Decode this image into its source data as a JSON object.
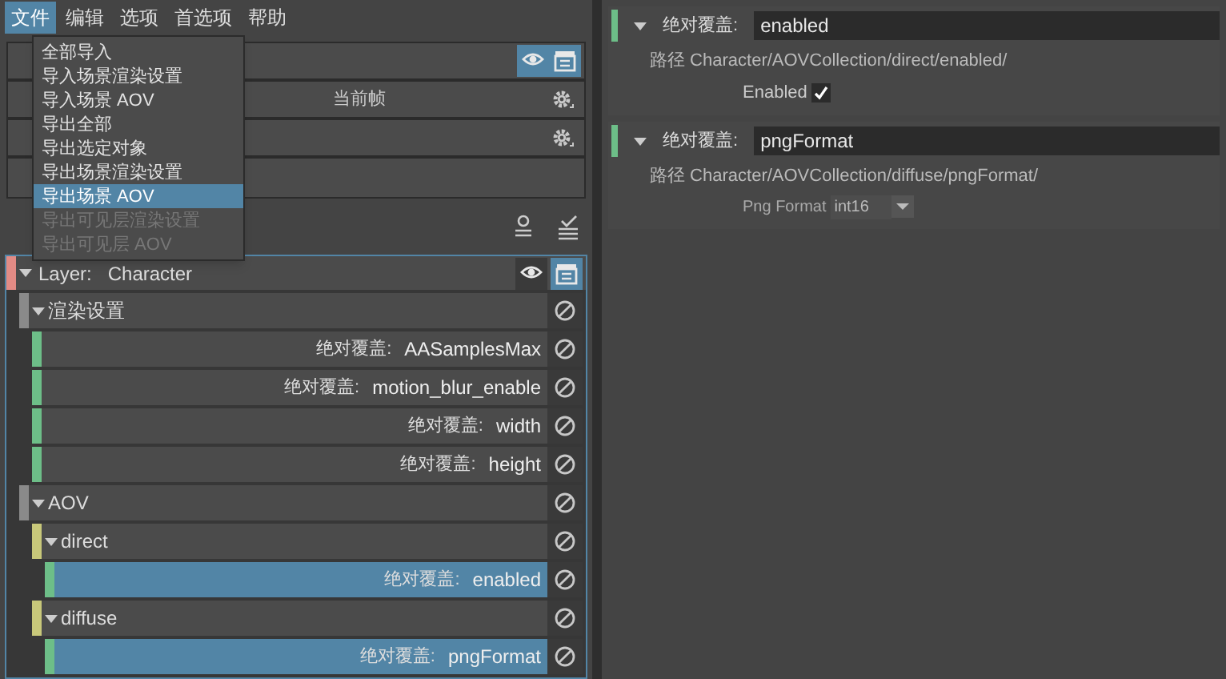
{
  "menu_bar": [
    {
      "label": "文件",
      "selected": true
    },
    {
      "label": "编辑",
      "selected": false
    },
    {
      "label": "选项",
      "selected": false
    },
    {
      "label": "首选项",
      "selected": false
    },
    {
      "label": "帮助",
      "selected": false
    }
  ],
  "file_menu": [
    {
      "label": "全部导入",
      "selected": false,
      "disabled": false
    },
    {
      "label": "导入场景渲染设置",
      "selected": false,
      "disabled": false
    },
    {
      "label": "导入场景 AOV",
      "selected": false,
      "disabled": false
    },
    {
      "label": "导出全部",
      "selected": false,
      "disabled": false
    },
    {
      "label": "导出选定对象",
      "selected": false,
      "disabled": false
    },
    {
      "label": "导出场景渲染设置",
      "selected": false,
      "disabled": false
    },
    {
      "label": "导出场景 AOV",
      "selected": true,
      "disabled": false
    },
    {
      "label": "导出可见层渲染设置",
      "selected": false,
      "disabled": true
    },
    {
      "label": "导出可见层 AOV",
      "selected": false,
      "disabled": true
    }
  ],
  "top_panel": {
    "frame_label": "当前帧"
  },
  "layer": {
    "label": "Layer:",
    "name": "Character",
    "color": "#e38b85",
    "expanded": true,
    "children": [
      {
        "kind": "group",
        "label": "渲染设置",
        "color": "#8a8a8a",
        "expanded": true,
        "children": [
          {
            "kind": "override",
            "prefix": "绝对覆盖:",
            "label": "AASamplesMax",
            "color": "#6dbe88",
            "selected": false
          },
          {
            "kind": "override",
            "prefix": "绝对覆盖:",
            "label": "motion_blur_enable",
            "color": "#6dbe88",
            "selected": false
          },
          {
            "kind": "override",
            "prefix": "绝对覆盖:",
            "label": "width",
            "color": "#6dbe88",
            "selected": false
          },
          {
            "kind": "override",
            "prefix": "绝对覆盖:",
            "label": "height",
            "color": "#6dbe88",
            "selected": false
          }
        ]
      },
      {
        "kind": "group",
        "label": "AOV",
        "color": "#8a8a8a",
        "expanded": true,
        "children": [
          {
            "kind": "group",
            "label": "direct",
            "color": "#c8c87a",
            "expanded": true,
            "children": [
              {
                "kind": "override",
                "prefix": "绝对覆盖:",
                "label": "enabled",
                "color": "#6dbe88",
                "selected": true
              }
            ]
          },
          {
            "kind": "group",
            "label": "diffuse",
            "color": "#c8c87a",
            "expanded": true,
            "children": [
              {
                "kind": "override",
                "prefix": "绝对覆盖:",
                "label": "pngFormat",
                "color": "#6dbe88",
                "selected": true
              }
            ]
          }
        ]
      }
    ]
  },
  "properties": [
    {
      "label": "绝对覆盖:",
      "value": "enabled",
      "color": "#6dbe88",
      "path_label": "路径",
      "path": "Character/AOVCollection/direct/enabled/",
      "attribute": {
        "kind": "checkbox",
        "label": "Enabled",
        "checked": true
      }
    },
    {
      "label": "绝对覆盖:",
      "value": "pngFormat",
      "color": "#6dbe88",
      "path_label": "路径",
      "path": "Character/AOVCollection/diffuse/pngFormat/",
      "attribute": {
        "kind": "dropdown",
        "label": "Png Format",
        "value": "int16"
      }
    }
  ]
}
